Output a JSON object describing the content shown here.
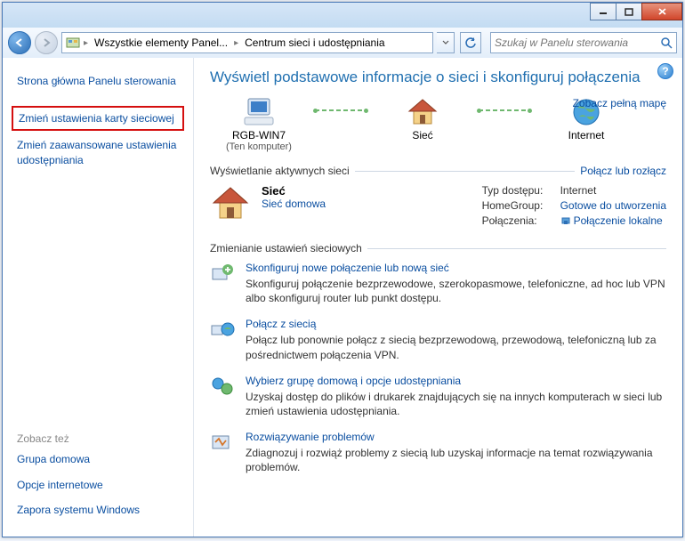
{
  "breadcrumbs": {
    "root": "Wszystkie elementy Panel...",
    "leaf": "Centrum sieci i udostępniania"
  },
  "search": {
    "placeholder": "Szukaj w Panelu sterowania"
  },
  "sidebar": {
    "home": "Strona główna Panelu sterowania",
    "links": [
      "Zmień ustawienia karty sieciowej",
      "Zmień zaawansowane ustawienia udostępniania"
    ],
    "see_also_hd": "Zobacz też",
    "see_also": [
      "Grupa domowa",
      "Opcje internetowe",
      "Zapora systemu Windows"
    ]
  },
  "main": {
    "title": "Wyświetl podstawowe informacje o sieci i skonfiguruj połączenia",
    "map_full": "Zobacz pełną mapę",
    "map": {
      "pc": "RGB-WIN7",
      "pc_sub": "(Ten komputer)",
      "net": "Sieć",
      "inet": "Internet"
    },
    "active_hd": "Wyświetlanie aktywnych sieci",
    "active_link": "Połącz lub rozłącz",
    "network": {
      "name": "Sieć",
      "kind": "Sieć domowa",
      "props": {
        "k1": "Typ dostępu:",
        "v1": "Internet",
        "k2": "HomeGroup:",
        "v2": "Gotowe do utworzenia",
        "k3": "Połączenia:",
        "v3": "Połączenie lokalne"
      }
    },
    "tasks_hd": "Zmienianie ustawień sieciowych",
    "tasks": [
      {
        "link": "Skonfiguruj nowe połączenie lub nową sieć",
        "desc": "Skonfiguruj połączenie bezprzewodowe, szerokopasmowe, telefoniczne, ad hoc lub VPN albo skonfiguruj router lub punkt dostępu."
      },
      {
        "link": "Połącz z siecią",
        "desc": "Połącz lub ponownie połącz z siecią bezprzewodową, przewodową, telefoniczną lub za pośrednictwem połączenia VPN."
      },
      {
        "link": "Wybierz grupę domową i opcje udostępniania",
        "desc": "Uzyskaj dostęp do plików i drukarek znajdujących się na innych komputerach w sieci lub zmień ustawienia udostępniania."
      },
      {
        "link": "Rozwiązywanie problemów",
        "desc": "Zdiagnozuj i rozwiąż problemy z siecią lub uzyskaj informacje na temat rozwiązywania problemów."
      }
    ]
  }
}
